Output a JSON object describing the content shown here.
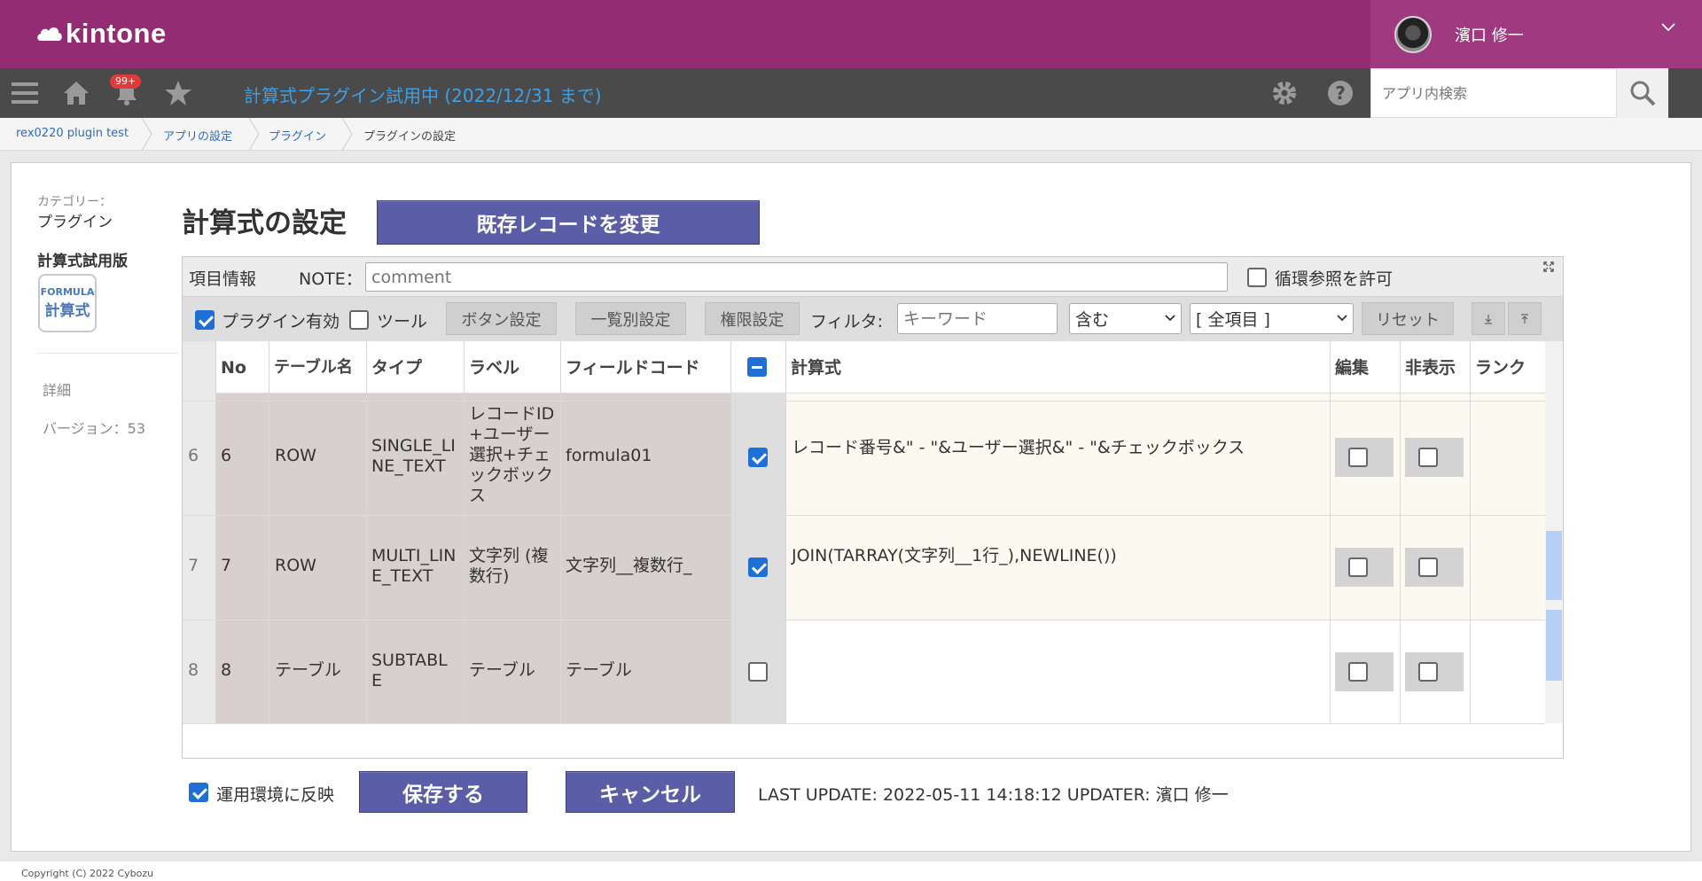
{
  "header": {
    "logo_text": "kintone",
    "user_name": "濱口 修一",
    "notification_count": "99+",
    "trial_notice": "計算式プラグイン試用中 (2022/12/31 まで)",
    "search_placeholder": "アプリ内検索"
  },
  "breadcrumb": [
    {
      "label": "rex0220 plugin test"
    },
    {
      "label": "アプリの設定"
    },
    {
      "label": "プラグイン"
    },
    {
      "label": "プラグインの設定"
    }
  ],
  "sidebar": {
    "category_label": "カテゴリー：",
    "category_value": "プラグイン",
    "plugin_name": "計算式試用版",
    "plugin_icon_line1": "FORMULA",
    "plugin_icon_line2": "計算式",
    "detail_link": "詳細",
    "version": "バージョン：53"
  },
  "main": {
    "title": "計算式の設定",
    "change_records_button": "既存レコードを変更",
    "field_info_label": "項目情報",
    "note_label": "NOTE：",
    "note_placeholder": "comment",
    "circular_ref_label": "循環参照を許可",
    "circular_ref_checked": false,
    "plugin_enabled_label": "プラグイン有効",
    "plugin_enabled_checked": true,
    "tools_label": "ツール",
    "tools_checked": false,
    "button_settings": "ボタン設定",
    "list_settings": "一覧別設定",
    "permission_settings": "権限設定",
    "filter_label": "フィルタ:",
    "keyword_placeholder": "キーワード",
    "match_select": "含む",
    "field_select": "[ 全項目 ]",
    "reset_button": "リセット"
  },
  "table": {
    "headers": {
      "no": "No",
      "table_name": "テーブル名",
      "type": "タイプ",
      "label": "ラベル",
      "field_code": "フィールドコード",
      "formula": "計算式",
      "edit": "編集",
      "hidden": "非表示",
      "rank": "ランク"
    },
    "rows": [
      {
        "row_num": "6",
        "no": "6",
        "table_name": "ROW",
        "type": "SINGLE_LINE_TEXT",
        "label": "レコードID+ユーザー選択+チェックボックス",
        "field_code": "formula01",
        "enabled": true,
        "formula": "レコード番号&\" - \"&ユーザー選択&\" - \"&チェックボックス",
        "edit": false,
        "hidden": false
      },
      {
        "row_num": "7",
        "no": "7",
        "table_name": "ROW",
        "type": "MULTI_LINE_TEXT",
        "label": "文字列 (複数行)",
        "field_code": "文字列__複数行_",
        "enabled": true,
        "formula": "JOIN(TARRAY(文字列__1行_),NEWLINE())",
        "edit": false,
        "hidden": false
      },
      {
        "row_num": "8",
        "no": "8",
        "table_name": "テーブル",
        "type": "SUBTABLE",
        "label": "テーブル",
        "field_code": "テーブル",
        "enabled": false,
        "formula": "",
        "edit": false,
        "hidden": false
      }
    ]
  },
  "bottom": {
    "reflect_label": "運用環境に反映",
    "reflect_checked": true,
    "save_button": "保存する",
    "cancel_button": "キャンセル",
    "last_update": "LAST UPDATE: 2022-05-11 14:18:12 UPDATER: 濱口 修一"
  },
  "footer": {
    "copyright": "Copyright (C) 2022 Cybozu"
  },
  "colors": {
    "header_bg": "#932c72",
    "toolbar_bg": "#4a4a4a",
    "accent_blue": "#1e6fd6",
    "button_purple": "#5b5ea6",
    "trial_text": "#3aa0e8"
  }
}
